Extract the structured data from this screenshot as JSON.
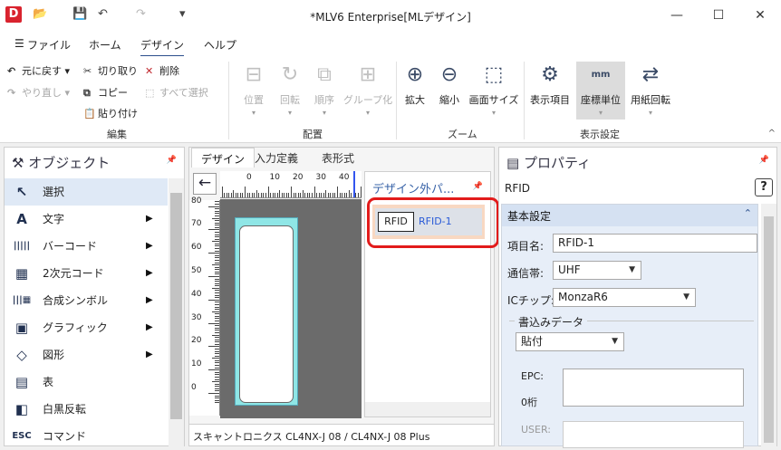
{
  "window": {
    "app_icon": "D",
    "title": "*MLV6 Enterprise[MLデザイン]",
    "controls": {
      "minimize": "—",
      "maximize": "☐",
      "close": "✕"
    },
    "quick_access": {
      "open": "📂",
      "save": "💾",
      "undo": "↶",
      "redo": "↷",
      "customize": "▾"
    }
  },
  "menu": {
    "file": "ファイル",
    "home": "ホーム",
    "design": "デザイン",
    "help": "ヘルプ"
  },
  "ribbon": {
    "edit": {
      "undo": "元に戻す",
      "redo": "やり直し",
      "cut": "切り取り",
      "copy": "コピー",
      "paste": "貼り付け",
      "delete": "削除",
      "select_all": "すべて選択",
      "group_label": "編集"
    },
    "layout": {
      "position": "位置",
      "rotate": "回転",
      "order": "順序",
      "group": "グループ化",
      "group_label": "配置"
    },
    "zoom": {
      "zoom_in": "拡大",
      "zoom_out": "縮小",
      "screen_size": "画面サイズ",
      "group_label": "ズーム"
    },
    "display": {
      "display_items": "表示項目",
      "coord_unit": "座標単位",
      "coord_unit_icon_text": "mm",
      "paper_rotate": "用紙回転",
      "group_label": "表示設定"
    },
    "collapse": "^"
  },
  "objects": {
    "title": "オブジェクト",
    "items": [
      {
        "label": "選択",
        "icon": "arrow-cursor-icon",
        "glyph": "↖",
        "submenu": false
      },
      {
        "label": "文字",
        "icon": "text-a-icon",
        "glyph": "A",
        "submenu": true
      },
      {
        "label": "バーコード",
        "icon": "barcode-icon",
        "glyph": "|||||",
        "submenu": true
      },
      {
        "label": "2次元コード",
        "icon": "qr-code-icon",
        "glyph": "▦",
        "submenu": true
      },
      {
        "label": "合成シンボル",
        "icon": "composite-symbol-icon",
        "glyph": "|||▦",
        "submenu": true
      },
      {
        "label": "グラフィック",
        "icon": "image-icon",
        "glyph": "▣",
        "submenu": true
      },
      {
        "label": "図形",
        "icon": "shapes-icon",
        "glyph": "◇",
        "submenu": true
      },
      {
        "label": "表",
        "icon": "table-icon",
        "glyph": "▤",
        "submenu": false
      },
      {
        "label": "白黒反転",
        "icon": "invert-icon",
        "glyph": "◧",
        "submenu": false
      },
      {
        "label": "コマンド",
        "icon": "esc-command-icon",
        "glyph": "ESC",
        "submenu": false
      }
    ]
  },
  "design": {
    "tabs": [
      "デザイン",
      "入力定義",
      "表形式"
    ],
    "back": "←",
    "ruler_h": [
      "0",
      "10",
      "20",
      "30",
      "40"
    ],
    "ruler_v": [
      "80",
      "70",
      "60",
      "50",
      "40",
      "30",
      "20",
      "10",
      "0"
    ],
    "outside": {
      "title": "デザイン外パ...",
      "item_badge": "RFID",
      "item_name": "RFID-1"
    },
    "status": "スキャントロニクス CL4NX-J 08 / CL4NX-J 08 Plus"
  },
  "properties": {
    "title": "プロパティ",
    "object_type": "RFID",
    "help": "?",
    "section": "基本設定",
    "fields": {
      "item_name_label": "項目名:",
      "item_name": "RFID-1",
      "comm_band_label": "通信帯:",
      "comm_band": "UHF",
      "ic_chip_label": "ICチップ:",
      "ic_chip": "MonzaR6"
    },
    "write_data": {
      "title": "書込みデータ",
      "mode": "貼付",
      "epc_label": "EPC:",
      "epc_digits": "0桁",
      "user_label": "USER:"
    }
  }
}
